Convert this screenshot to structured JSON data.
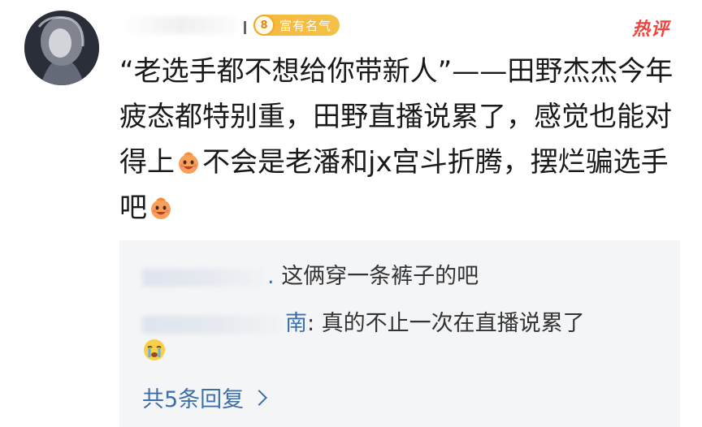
{
  "comment": {
    "badge": {
      "level": "8",
      "label": "富有名气"
    },
    "hot_tag": "热评",
    "text_segments": [
      "“老选手都不想给你带新人”——田野杰杰今年疲态都特别重，田野直播说累了，感觉也能对得上",
      "不会是老潘和jx宫斗折腾，摆烂骗选手吧"
    ],
    "emoji": "laugh-emoji"
  },
  "replies": {
    "items": [
      {
        "author_visible": ".",
        "text": "这俩穿一条裤子的吧"
      },
      {
        "author_visible": "南",
        "text": ": 真的不止一次在直播说累了"
      }
    ],
    "trailing_emoji": "cry-emoji",
    "more_label": "共5条回复"
  },
  "colors": {
    "badge": "#f4b93c",
    "hot_tag": "#f0453f",
    "link": "#3d6fa8",
    "reply_bg": "#f4f5f7",
    "text": "#1a1a1a"
  }
}
